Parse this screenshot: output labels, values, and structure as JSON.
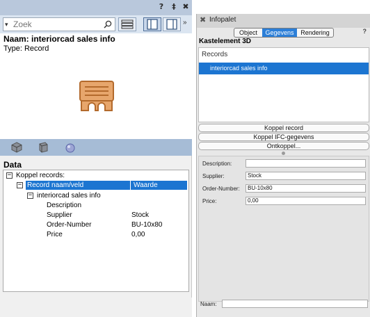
{
  "left_panel": {
    "titlebar": {
      "help": "?",
      "pin": "‡",
      "close": "✖"
    },
    "search": {
      "placeholder": "Zoek",
      "dropdown": "▾"
    },
    "more": "»",
    "info": {
      "name_line": "Naam: interiorcad sales info",
      "type_line": "Type: Record"
    },
    "data": {
      "title": "Data",
      "tree": {
        "root_toggle": "−",
        "root_label": "Koppel records:",
        "header_toggle": "−",
        "header_col1": "Record naam/veld",
        "header_col2": "Waarde",
        "record_toggle": "−",
        "record_name": "interiorcad sales info",
        "fields": [
          {
            "name": "Description",
            "value": ""
          },
          {
            "name": "Supplier",
            "value": "Stock"
          },
          {
            "name": "Order-Number",
            "value": "BU-10x80"
          },
          {
            "name": "Price",
            "value": "0,00"
          }
        ]
      }
    }
  },
  "right_panel": {
    "close": "✖",
    "title": "Infopalet",
    "help": "?",
    "tabs": [
      {
        "label": "Object"
      },
      {
        "label": "Gegevens"
      },
      {
        "label": "Rendering"
      }
    ],
    "element_title": "Kastelement 3D",
    "records": {
      "label": "Records",
      "items": [
        "interiorcad sales info"
      ]
    },
    "buttons": [
      "Koppel record",
      "Koppel IFC-gegevens",
      "Ontkoppel..."
    ],
    "fields": [
      {
        "label": "Description:",
        "value": ""
      },
      {
        "label": "Supplier:",
        "value": "Stock"
      },
      {
        "label": "Order-Number:",
        "value": "BU-10x80"
      },
      {
        "label": "Price:",
        "value": "0,00"
      }
    ],
    "naam_label": "Naam:",
    "naam_value": ""
  },
  "colors": {
    "selection": "#1c75d1",
    "titlebar": "#b9c8dc",
    "toolbar": "#a6bcd6",
    "record_icon": "#d08a4a"
  }
}
